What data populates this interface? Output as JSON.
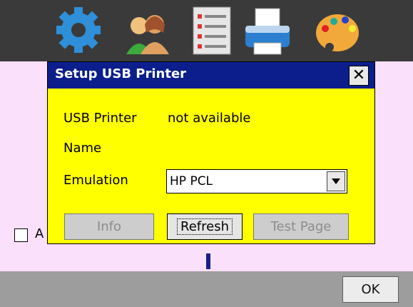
{
  "toolbar": {
    "icons": [
      "gear-icon",
      "users-icon",
      "list-icon",
      "printer-icon",
      "palette-icon"
    ]
  },
  "background": {
    "checkbox_label": "A",
    "ok_label": "OK"
  },
  "dialog": {
    "title": "Setup USB Printer",
    "close_label": "✕",
    "usb_printer_label": "USB Printer",
    "usb_printer_value": "not available",
    "name_label": "Name",
    "emulation_label": "Emulation",
    "emulation_value": "HP PCL",
    "info_label": "Info",
    "refresh_label": "Refresh",
    "test_page_label": "Test Page"
  },
  "colors": {
    "title_bar": "#0b1e8c",
    "dialog_bg": "#ffff00",
    "page_bg": "#fbe0fb",
    "top_bar": "#3a3a3a"
  }
}
